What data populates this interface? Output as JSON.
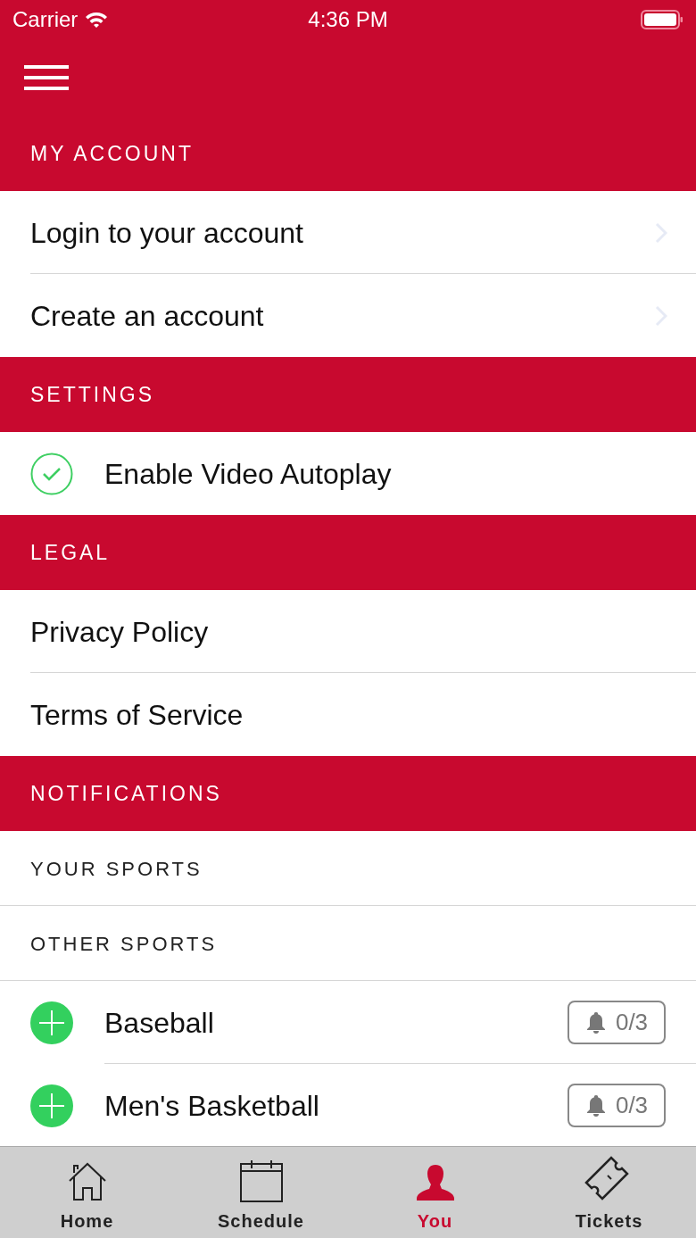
{
  "status_bar": {
    "carrier": "Carrier",
    "time": "4:36 PM"
  },
  "sections": [
    {
      "header": "MY ACCOUNT",
      "items": [
        {
          "kind": "link",
          "label": "Login to your account"
        },
        {
          "kind": "link",
          "label": "Create an account"
        }
      ]
    },
    {
      "header": "SETTINGS",
      "items": [
        {
          "kind": "check",
          "label": "Enable Video Autoplay",
          "checked": true
        }
      ]
    },
    {
      "header": "LEGAL",
      "items": [
        {
          "kind": "plain",
          "label": "Privacy Policy"
        },
        {
          "kind": "plain",
          "label": "Terms of Service"
        }
      ]
    },
    {
      "header": "NOTIFICATIONS",
      "items": [
        {
          "kind": "subheader",
          "label": "YOUR SPORTS"
        },
        {
          "kind": "subheader",
          "label": "OTHER SPORTS"
        },
        {
          "kind": "sport",
          "label": "Baseball",
          "count": "0/3"
        },
        {
          "kind": "sport",
          "label": "Men's Basketball",
          "count": "0/3"
        }
      ]
    }
  ],
  "tab_bar": [
    {
      "label": "Home",
      "kind": "home",
      "selected": false
    },
    {
      "label": "Schedule",
      "kind": "calendar",
      "selected": false
    },
    {
      "label": "You",
      "kind": "person",
      "selected": true
    },
    {
      "label": "Tickets",
      "kind": "ticket",
      "selected": false
    }
  ]
}
